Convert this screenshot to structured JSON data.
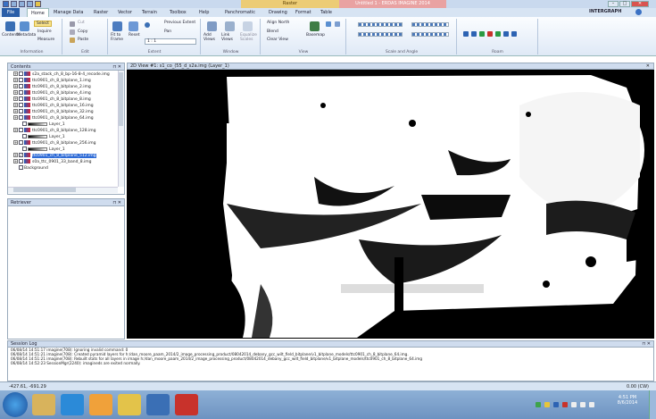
{
  "titlebar": {
    "context_tab_group": "Raster",
    "app_title": "Untitled 1 - ERDAS IMAGINE 2014",
    "user_label": "INTERGRAPH"
  },
  "tabs": [
    "File",
    "Home",
    "Manage Data",
    "Raster",
    "Vector",
    "Terrain",
    "Toolbox",
    "Help",
    "Panchromatic",
    "Drawing",
    "Format",
    "Table"
  ],
  "ribbon": {
    "information": {
      "label": "Information",
      "contents": "Contents",
      "metadata": "Metadata",
      "select": "Select",
      "inquire": "Inquire",
      "measure": "Measure"
    },
    "edit": {
      "label": "Edit",
      "cut": "Cut",
      "copy": "Copy",
      "paste": "Paste"
    },
    "extent": {
      "label": "Extent",
      "fit_to_frame": "Fit to Frame",
      "reset": "Reset",
      "scale": "1 : 1",
      "previous_extent": "Previous Extent",
      "pan": "Pan"
    },
    "window": {
      "label": "Window",
      "add_views": "Add Views",
      "link_views": "Link Views",
      "equalize_scales": "Equalize Scales"
    },
    "view": {
      "label": "View",
      "align_north": "Align North",
      "blend": "Blend",
      "clear_view": "Clear View",
      "basemap": "Basemap"
    },
    "scale_angle": {
      "label": "Scale and Angle"
    },
    "roam": {
      "label": "Roam"
    }
  },
  "contents": {
    "title": "Contents",
    "items": [
      {
        "label": "s2a_stack_ch_8_bp-16-8-4_recode.img",
        "kind": "layer",
        "checked": false
      },
      {
        "label": "ttc0901_ch_8_bitplane_1.img",
        "kind": "layer",
        "checked": false
      },
      {
        "label": "ttc0901_ch_8_bitplane_2.img",
        "kind": "layer",
        "checked": false
      },
      {
        "label": "ttc0901_ch_8_bitplane_4.img",
        "kind": "layer",
        "checked": false
      },
      {
        "label": "ttc0901_ch_8_bitplane_8.img",
        "kind": "layer",
        "checked": false
      },
      {
        "label": "ttc0901_ch_8_bitplane_16.img",
        "kind": "layer",
        "checked": false
      },
      {
        "label": "ttc0901_ch_8_bitplane_32.img",
        "kind": "layer",
        "checked": false
      },
      {
        "label": "ttc0901_ch_8_bitplane_64.img",
        "kind": "layer",
        "checked": false
      },
      {
        "label": "Layer_1",
        "kind": "ramp"
      },
      {
        "label": "ttc0901_ch_8_bitplane_128.img",
        "kind": "layer",
        "checked": false
      },
      {
        "label": "Layer_1",
        "kind": "ramp"
      },
      {
        "label": "ttc0901_ch_8_bitplane_256.img",
        "kind": "layer",
        "checked": false
      },
      {
        "label": "Layer_1",
        "kind": "ramp"
      },
      {
        "label": "ttc0901_ch_8_bitplane_512.img",
        "kind": "layer",
        "checked": true,
        "selected": true
      },
      {
        "label": "s0a_ttc_0901_33_band_8.img",
        "kind": "layer",
        "checked": false
      },
      {
        "label": "Background",
        "kind": "background",
        "checked": false
      }
    ]
  },
  "retriever": {
    "title": "Retriever"
  },
  "view": {
    "title": "2D View #1: s1_co_(55_d_s2a.img (Layer_1)"
  },
  "session_log": {
    "title": "Session Log",
    "lines": [
      "06/08/14 14:51:17 imagine(708): Ignoring invalid command: 0",
      "06/08/14 14:51:21 imagine(708): Created pyramid layers for h:/dan_moore_paam_2014/2_image_processing_product/08042014_debany_gcc_wilt_field_bitplane/v1_bitplane_models/ttc0901_ch_8_bitplane_64.img.",
      "06/08/14 14:51:21 imagine(708): Rebuilt stats for all layers in image h:/dan_moore_paam_2014/2_image_processing_product/08042014_debany_gcc_wilt_field_bitplane/v1_bitplane_models/ttc0901_ch_8_bitplane_64.img",
      "06/08/14 14:52:23 SessionMgr(2240): imagineds are exited normally."
    ]
  },
  "status": {
    "coords": "-427.61, -691.29",
    "right": "0.00 (CW)"
  },
  "taskbar": {
    "time": "4:51 PM",
    "date": "8/6/2014"
  }
}
